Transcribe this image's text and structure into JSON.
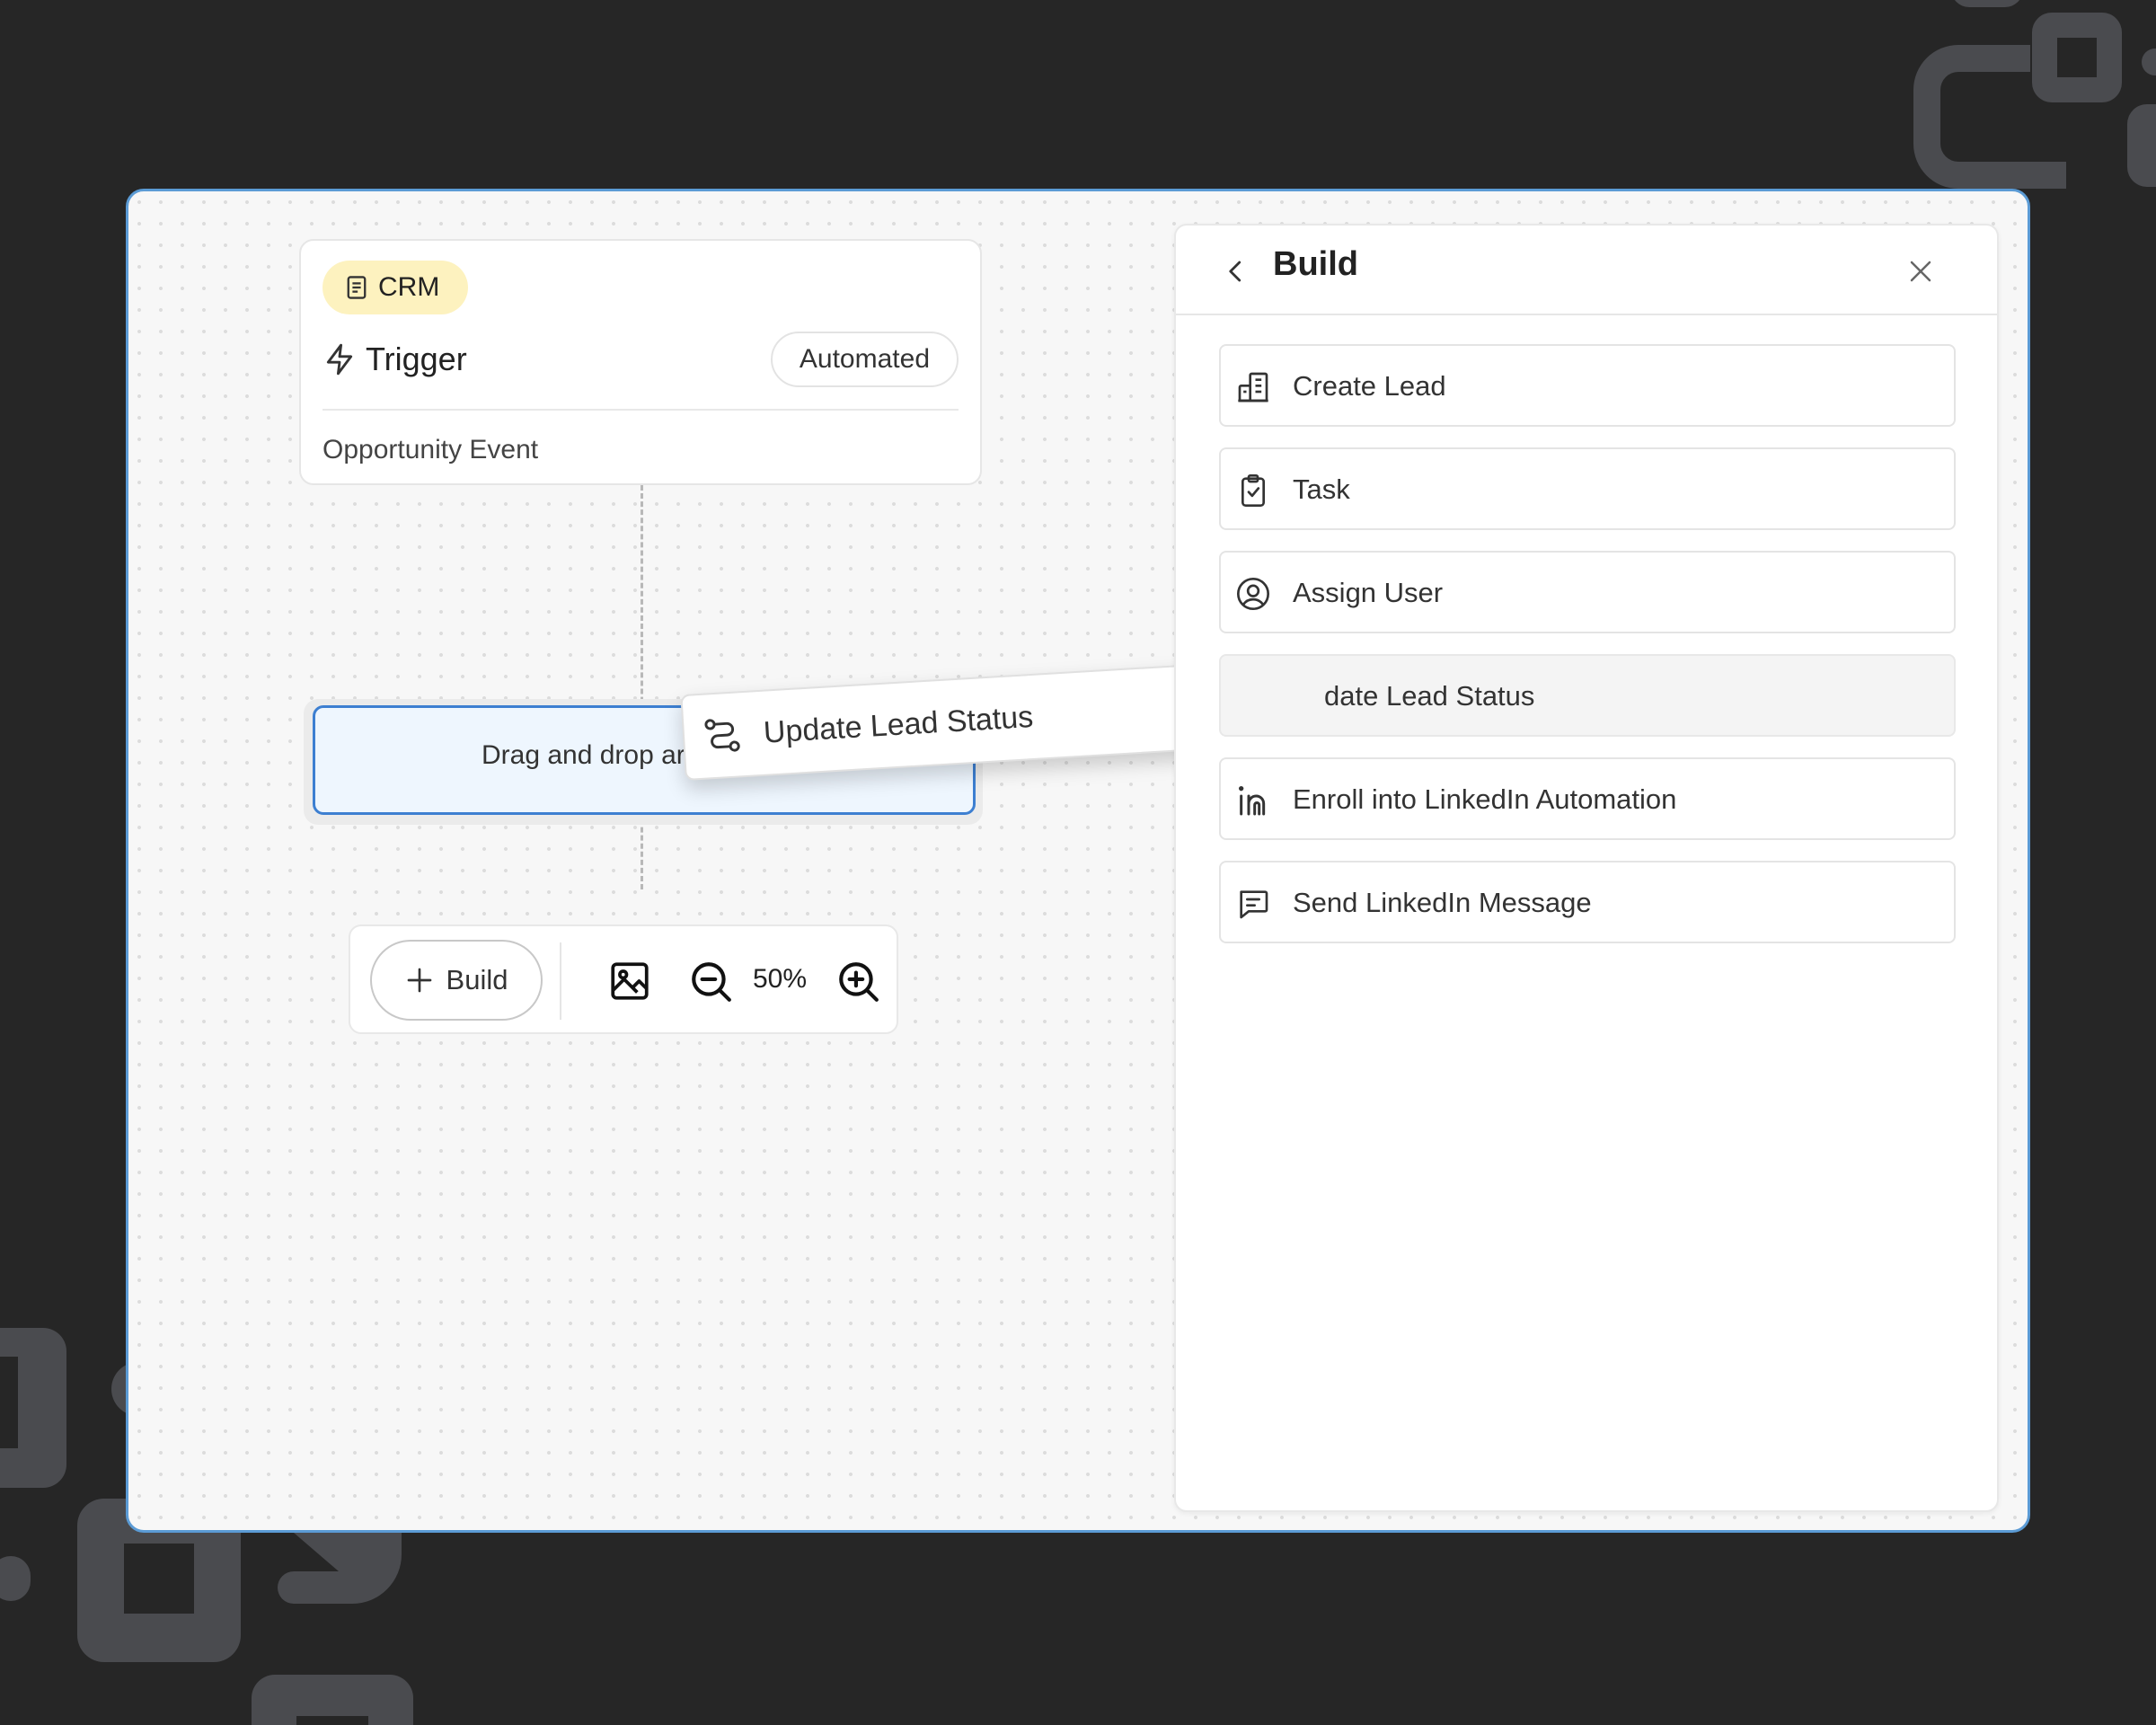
{
  "canvas": {
    "trigger_card": {
      "badge_label": "CRM",
      "title": "Trigger",
      "mode_label": "Automated",
      "subtitle": "Opportunity Event"
    },
    "drop_zone": {
      "label": "Drag and drop ar"
    },
    "dragging_item": {
      "label": "Update Lead Status",
      "icon": "route-icon"
    },
    "toolbar": {
      "build_label": "Build",
      "zoom_level": "50%"
    }
  },
  "build_panel": {
    "title": "Build",
    "actions": [
      {
        "label": "Create Lead",
        "icon": "building-icon"
      },
      {
        "label": "Task",
        "icon": "clipboard-check-icon"
      },
      {
        "label": "Assign User",
        "icon": "user-circle-icon"
      },
      {
        "label": "date Lead Status",
        "icon": "route-icon",
        "state": "dragging-placeholder"
      },
      {
        "label": "Enroll into LinkedIn Automation",
        "icon": "linkedin-icon"
      },
      {
        "label": "Send LinkedIn Message",
        "icon": "message-icon"
      }
    ]
  },
  "colors": {
    "background": "#262626",
    "window_border": "#5b9bd5",
    "crm_badge": "#fdf2bf",
    "drop_zone_fill": "#eef6fe",
    "drop_zone_border": "#3d7fd1"
  }
}
